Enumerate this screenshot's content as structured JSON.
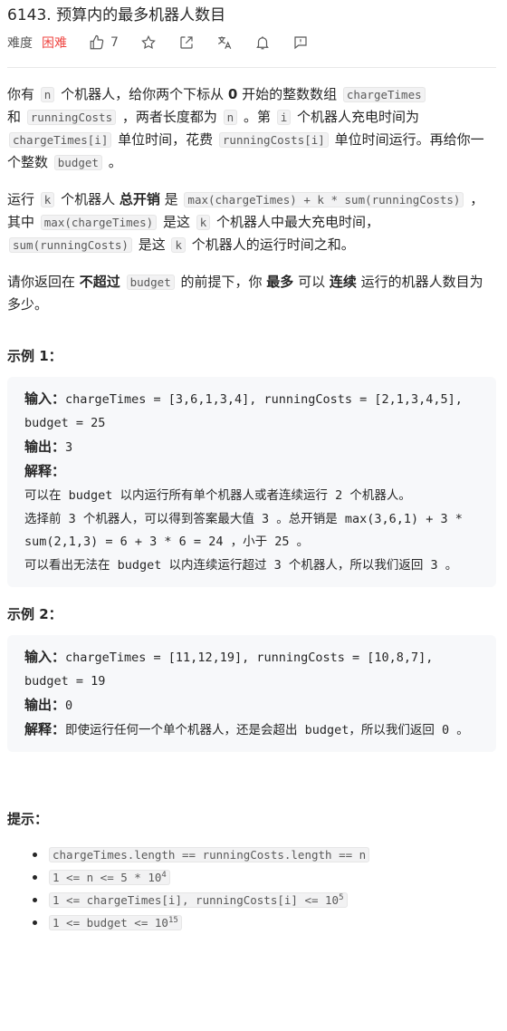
{
  "header": {
    "title": "6143. 预算内的最多机器人数目",
    "difficulty_label": "难度",
    "difficulty_value": "困难",
    "like_count": "7"
  },
  "description": {
    "p1": {
      "t1": "你有 ",
      "c1": "n",
      "t2": " 个机器人，给你两个下标从 ",
      "b1": "0",
      "t3": " 开始的整数数组 ",
      "c2": "chargeTimes",
      "t4": " 和 ",
      "c3": "runningCosts",
      "t5": " ，两者长度都为 ",
      "c4": "n",
      "t6": " 。第 ",
      "c5": "i",
      "t7": " 个机器人充电时间为 ",
      "c6": "chargeTimes[i]",
      "t8": " 单位时间，花费 ",
      "c7": "runningCosts[i]",
      "t9": " 单位时间运行。再给你一个整数 ",
      "c8": "budget",
      "t10": " 。"
    },
    "p2": {
      "t1": "运行 ",
      "c1": "k",
      "t2": " 个机器人 ",
      "b1": "总开销",
      "t3": " 是 ",
      "c2": "max(chargeTimes) + k * sum(runningCosts)",
      "t4": " ，其中 ",
      "c3": "max(chargeTimes)",
      "t5": " 是这 ",
      "c4": "k",
      "t6": " 个机器人中最大充电时间，",
      "c5": "sum(runningCosts)",
      "t7": " 是这 ",
      "c6": "k",
      "t8": " 个机器人的运行时间之和。"
    },
    "p3": {
      "t1": "请你返回在 ",
      "b1": "不超过",
      "t2": " ",
      "c1": "budget",
      "t3": " 的前提下，你 ",
      "b2": "最多",
      "t4": " 可以 ",
      "b3": "连续",
      "t5": " 运行的机器人数目为多少。"
    }
  },
  "examples": [
    {
      "title": "示例 1：",
      "input_label": "输入：",
      "input": "chargeTimes = [3,6,1,3,4], runningCosts = [2,1,3,4,5], budget = 25",
      "output_label": "输出：",
      "output": "3",
      "explain_label": "解释：",
      "explain": "\n可以在 budget 以内运行所有单个机器人或者连续运行 2 个机器人。\n选择前 3 个机器人，可以得到答案最大值 3 。总开销是 max(3,6,1) + 3 * sum(2,1,3) = 6 + 3 * 6 = 24 ，小于 25 。\n可以看出无法在 budget 以内连续运行超过 3 个机器人，所以我们返回 3 。"
    },
    {
      "title": "示例 2：",
      "input_label": "输入：",
      "input": "chargeTimes = [11,12,19], runningCosts = [10,8,7], budget = 19",
      "output_label": "输出：",
      "output": "0",
      "explain_label": "解释：",
      "explain": "即使运行任何一个单个机器人，还是会超出 budget，所以我们返回 0 。"
    }
  ],
  "tips": {
    "title": "提示：",
    "items": [
      {
        "text": "chargeTimes.length == runningCosts.length == n",
        "sup": ""
      },
      {
        "text": "1 <= n <= 5 * 10",
        "sup": "4"
      },
      {
        "text": "1 <= chargeTimes[i], runningCosts[i] <= 10",
        "sup": "5"
      },
      {
        "text": "1 <= budget <= 10",
        "sup": "15"
      }
    ]
  },
  "colors": {
    "difficulty": "#ef4743",
    "code_bg": "#f2f2f3",
    "example_bg": "#f7f8fa"
  },
  "icons": [
    "thumbs-up-icon",
    "star-icon",
    "share-icon",
    "translate-icon",
    "bell-icon",
    "feedback-icon"
  ]
}
